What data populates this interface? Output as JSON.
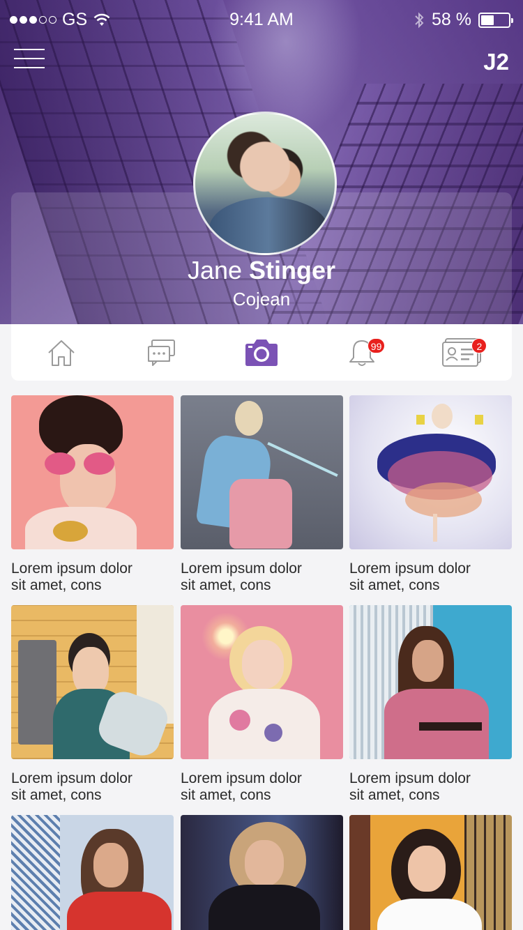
{
  "status_bar": {
    "carrier": "GS",
    "time": "9:41 AM",
    "battery": "58 %"
  },
  "header": {
    "initials": "J2"
  },
  "profile": {
    "first_name": "Jane",
    "last_name": "Stinger",
    "subtitle": "Cojean"
  },
  "tabs": [
    {
      "name": "home",
      "icon": "home-icon",
      "active": false
    },
    {
      "name": "messages",
      "icon": "chat-icon",
      "active": false
    },
    {
      "name": "photos",
      "icon": "camera-icon",
      "active": true
    },
    {
      "name": "notifications",
      "icon": "bell-icon",
      "active": false,
      "badge": "99"
    },
    {
      "name": "contact",
      "icon": "contact-card-icon",
      "active": false,
      "badge": "2"
    }
  ],
  "colors": {
    "accent": "#7b52b5",
    "badge": "#e8201d",
    "icon_inactive": "#9a9a9a"
  },
  "gallery": [
    {
      "caption_line1": "Lorem ipsum dolor",
      "caption_line2": "sit amet, cons"
    },
    {
      "caption_line1": "Lorem ipsum dolor",
      "caption_line2": "sit amet, cons"
    },
    {
      "caption_line1": "Lorem ipsum dolor",
      "caption_line2": "sit amet, cons"
    },
    {
      "caption_line1": "Lorem ipsum dolor",
      "caption_line2": "sit amet, cons"
    },
    {
      "caption_line1": "Lorem ipsum dolor",
      "caption_line2": "sit amet, cons"
    },
    {
      "caption_line1": "Lorem ipsum dolor",
      "caption_line2": "sit amet, cons"
    },
    {
      "caption_line1": "",
      "caption_line2": ""
    },
    {
      "caption_line1": "",
      "caption_line2": ""
    },
    {
      "caption_line1": "",
      "caption_line2": ""
    }
  ]
}
